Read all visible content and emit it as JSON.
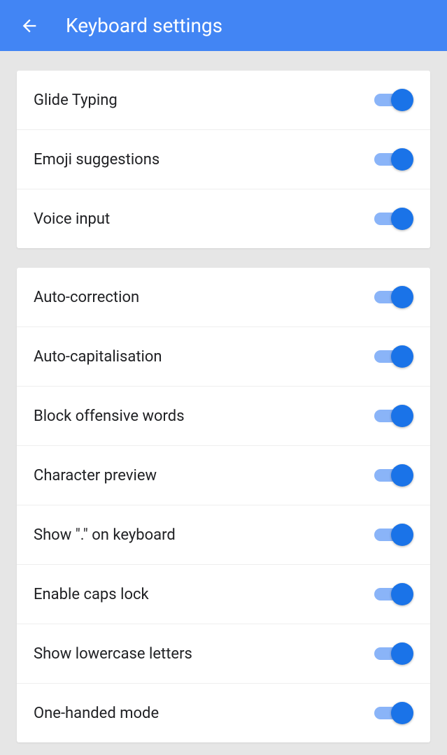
{
  "header": {
    "title": "Keyboard settings"
  },
  "sections": [
    {
      "items": [
        {
          "label": "Glide Typing",
          "on": true
        },
        {
          "label": "Emoji suggestions",
          "on": true
        },
        {
          "label": "Voice input",
          "on": true
        }
      ]
    },
    {
      "items": [
        {
          "label": "Auto-correction",
          "on": true
        },
        {
          "label": "Auto-capitalisation",
          "on": true
        },
        {
          "label": "Block offensive words",
          "on": true
        },
        {
          "label": "Character preview",
          "on": true
        },
        {
          "label": "Show \".\" on keyboard",
          "on": true
        },
        {
          "label": "Enable caps lock",
          "on": true
        },
        {
          "label": "Show lowercase letters",
          "on": true
        },
        {
          "label": "One-handed mode",
          "on": true
        }
      ]
    }
  ]
}
